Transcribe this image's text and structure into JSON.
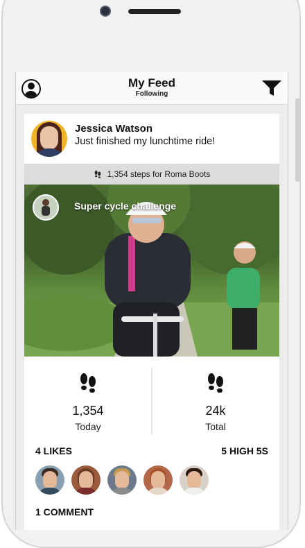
{
  "header": {
    "title": "My Feed",
    "subtitle": "Following"
  },
  "post": {
    "author_name": "Jessica Watson",
    "message": "Just finished my lunchtime ride!",
    "steps_banner": "1,354 steps for Roma Boots",
    "photo_caption": "Super cycle challenge"
  },
  "stats": [
    {
      "value": "1,354",
      "label": "Today"
    },
    {
      "value": "24k",
      "label": "Total"
    }
  ],
  "social": {
    "likes": "4 LIKES",
    "high_fives": "5 HIGH 5S",
    "comments": "1 COMMENT"
  },
  "colors": {
    "accent": "#111111",
    "banner_bg": "#dcdcdc",
    "screen_bg": "#ececec"
  },
  "icons": [
    "user-profile-icon",
    "filter-funnel-icon",
    "footsteps-icon"
  ]
}
